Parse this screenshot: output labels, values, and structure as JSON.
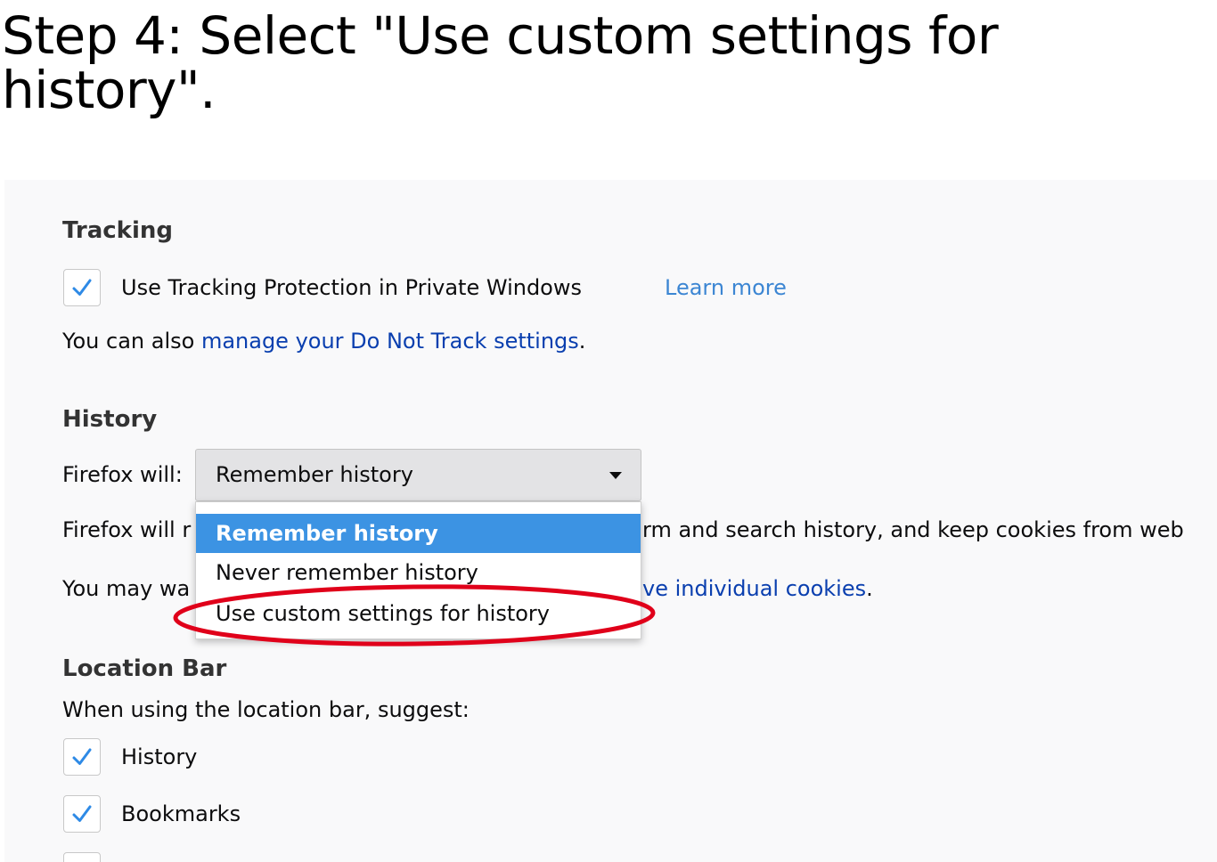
{
  "step_title": "Step 4: Select \"Use custom settings for history\".",
  "tracking": {
    "heading": "Tracking",
    "checkbox_label": "Use Tracking Protection in Private Windows",
    "checkbox_checked": true,
    "learn_more": "Learn more",
    "dnt_prefix": "You can also ",
    "dnt_link": "manage your Do Not Track settings",
    "dnt_suffix": "."
  },
  "history": {
    "heading": "History",
    "firefox_will_label": "Firefox will:",
    "dropdown_value": "Remember history",
    "options": [
      {
        "label": "Remember history",
        "selected": true
      },
      {
        "label": "Never remember history",
        "selected": false
      },
      {
        "label": "Use custom settings for history",
        "selected": false,
        "highlighted": true
      }
    ],
    "description_left": "Firefox will r",
    "description_right": "rm and search history, and keep cookies from web",
    "note_left": "You may wa",
    "note_link": "ve individual cookies",
    "note_suffix": "."
  },
  "location_bar": {
    "heading": "Location Bar",
    "suggest_label": "When using the location bar, suggest:",
    "items": [
      {
        "label": "History",
        "checked": true
      },
      {
        "label": "Bookmarks",
        "checked": true
      }
    ]
  },
  "colors": {
    "link": "#0a3faf",
    "learn_more": "#3c86d3",
    "selected_option": "#3c93e3",
    "checkmark": "#2e8ae6",
    "annotation": "#e0001a",
    "panel_bg": "#f9f9fa"
  }
}
